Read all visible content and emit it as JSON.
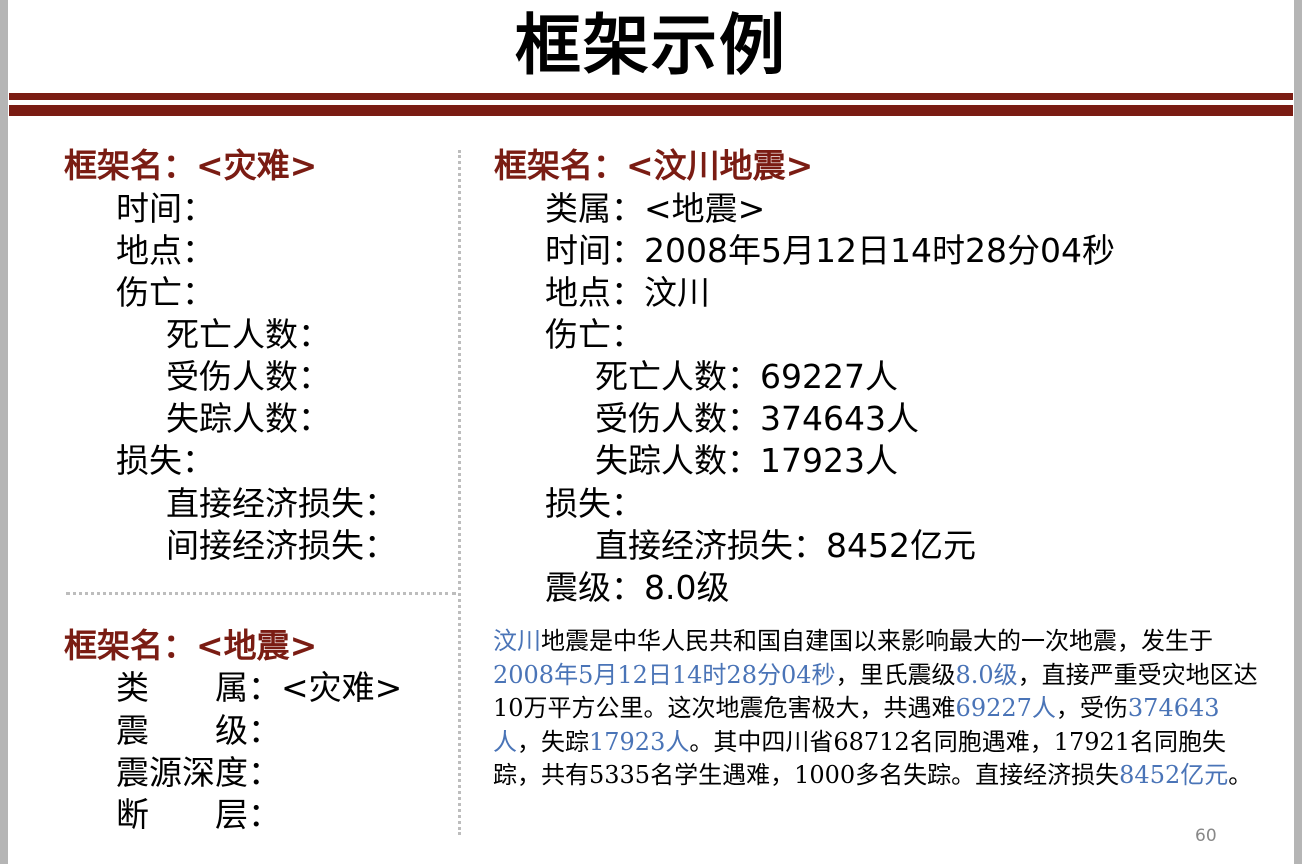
{
  "title": "框架示例",
  "page_number": "60",
  "frames": {
    "disaster": {
      "name": "框架名：<灾难>",
      "slots": [
        "时间：",
        "地点：",
        "伤亡：",
        "死亡人数：",
        "受伤人数：",
        "失踪人数：",
        "损失：",
        "直接经济损失：",
        "间接经济损失："
      ]
    },
    "earthquake": {
      "name": "框架名：<地震>",
      "slots": [
        "类　　属：<灾难>",
        "震　　级：",
        "震源深度：",
        "断　　层："
      ]
    },
    "wenchuan": {
      "name": "框架名：<汶川地震>",
      "slots": [
        "类属：<地震>",
        "时间：2008年5月12日14时28分04秒",
        "地点：汶川",
        "伤亡：",
        "死亡人数：69227人",
        "受伤人数：374643人",
        "失踪人数：17923人",
        "损失：",
        "直接经济损失：8452亿元",
        "震级：8.0级"
      ]
    }
  },
  "paragraph": {
    "segments": [
      {
        "text": "汶川",
        "highlight": true
      },
      {
        "text": "地震是中华人民共和国自建国以来影响最大的一次地震，发生于",
        "highlight": false
      },
      {
        "text": "2008年5月12日14时28分04秒",
        "highlight": true
      },
      {
        "text": "，里氏震级",
        "highlight": false
      },
      {
        "text": "8.0级",
        "highlight": true
      },
      {
        "text": "，直接严重受灾地区达10万平方公里。这次地震危害极大，共遇难",
        "highlight": false
      },
      {
        "text": "69227人",
        "highlight": true
      },
      {
        "text": "，受伤",
        "highlight": false
      },
      {
        "text": "374643人",
        "highlight": true
      },
      {
        "text": "，失踪",
        "highlight": false
      },
      {
        "text": "17923人",
        "highlight": true
      },
      {
        "text": "。其中四川省68712名同胞遇难，17921名同胞失踪，共有5335名学生遇难，1000多名失踪。直接经济损失",
        "highlight": false
      },
      {
        "text": "8452亿元",
        "highlight": true
      },
      {
        "text": "。",
        "highlight": false
      }
    ]
  },
  "colors": {
    "frame_name": "#7a1c13",
    "highlight": "#4a74b7",
    "rule": "#7a1c13"
  }
}
